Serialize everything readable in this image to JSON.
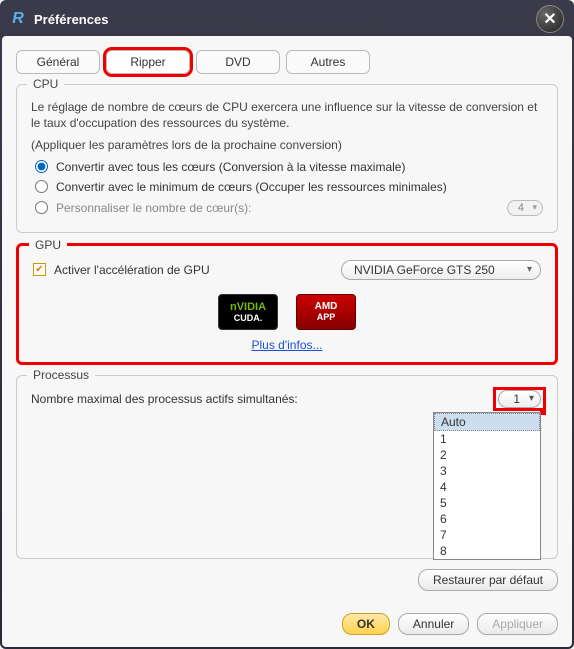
{
  "window": {
    "title": "Préférences"
  },
  "tabs": {
    "general": "Général",
    "ripper": "Ripper",
    "dvd": "DVD",
    "others": "Autres"
  },
  "cpu": {
    "title": "CPU",
    "desc": "Le réglage de nombre de cœurs de CPU exercera une influence sur la vitesse de conversion et le taux d'occupation des ressources du système.",
    "note": "(Appliquer les paramètres lors de la prochaine conversion)",
    "opt_all": "Convertir avec tous les cœurs (Conversion à la vitesse maximale)",
    "opt_min": "Convertir avec le minimum de cœurs (Occuper les ressources minimales)",
    "opt_custom": "Personnaliser le nombre de cœur(s):",
    "custom_value": "4"
  },
  "gpu": {
    "title": "GPU",
    "enable": "Activer l'accélération de GPU",
    "device": "NVIDIA GeForce GTS 250",
    "nvidia_top": "nVIDIA",
    "nvidia_bottom": "CUDA.",
    "amd_top": "AMD",
    "amd_bottom": "APP",
    "more": "Plus d'infos..."
  },
  "proc": {
    "title": "Processus",
    "label": "Nombre maximal des processus actifs simultanés:",
    "value": "1",
    "options": [
      "Auto",
      "1",
      "2",
      "3",
      "4",
      "5",
      "6",
      "7",
      "8"
    ]
  },
  "buttons": {
    "restore": "Restaurer par défaut",
    "ok": "OK",
    "cancel": "Annuler",
    "apply": "Appliquer"
  }
}
